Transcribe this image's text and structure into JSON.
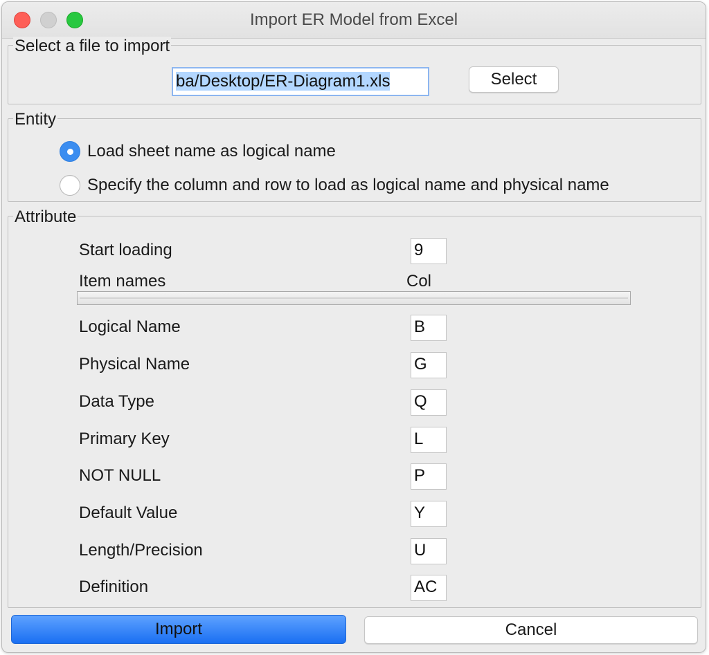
{
  "window": {
    "title": "Import ER Model from Excel"
  },
  "file_section": {
    "label": "Select a file to import",
    "file_path": "ba/Desktop/ER-Diagram1.xls",
    "select_button": "Select"
  },
  "entity_section": {
    "label": "Entity",
    "options": [
      {
        "label": "Load sheet name as logical name",
        "selected": true
      },
      {
        "label": "Specify the column and row to load as logical name and physical name",
        "selected": false
      }
    ]
  },
  "attribute_section": {
    "label": "Attribute",
    "start_loading_label": "Start loading",
    "start_loading_value": "9",
    "item_names_label": "Item names",
    "col_header": "Col",
    "fields": [
      {
        "label": "Logical Name",
        "value": "B"
      },
      {
        "label": "Physical Name",
        "value": "G"
      },
      {
        "label": "Data Type",
        "value": "Q"
      },
      {
        "label": "Primary Key",
        "value": "L"
      },
      {
        "label": "NOT NULL",
        "value": "P"
      },
      {
        "label": "Default Value",
        "value": "Y"
      },
      {
        "label": "Length/Precision",
        "value": "U"
      },
      {
        "label": "Definition",
        "value": "AC"
      }
    ]
  },
  "footer": {
    "import_button": "Import",
    "cancel_button": "Cancel"
  },
  "colors": {
    "accent": "#1a6ff2",
    "close": "#fe5f57",
    "maximize": "#28c840"
  }
}
